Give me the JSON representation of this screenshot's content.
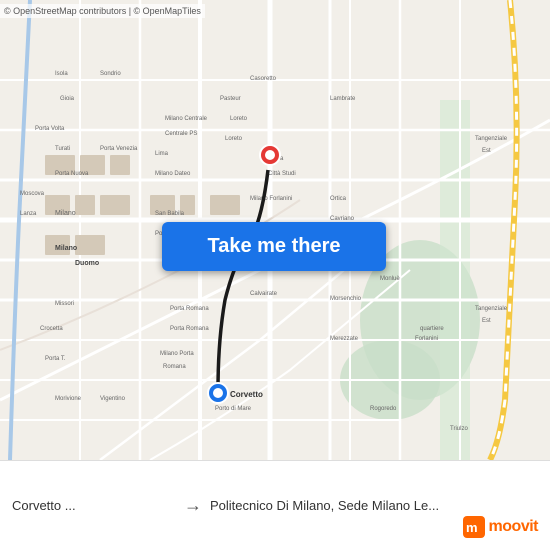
{
  "map": {
    "background_color": "#e8e0d8",
    "copyright": "© OpenStreetMap contributors | © OpenMapTiles"
  },
  "button": {
    "label": "Take me there"
  },
  "bottom_bar": {
    "from": "Corvetto ...",
    "arrow": "→",
    "to": "Politecnico Di Milano, Sede Milano Le..."
  },
  "branding": {
    "logo_text": "moovit"
  }
}
